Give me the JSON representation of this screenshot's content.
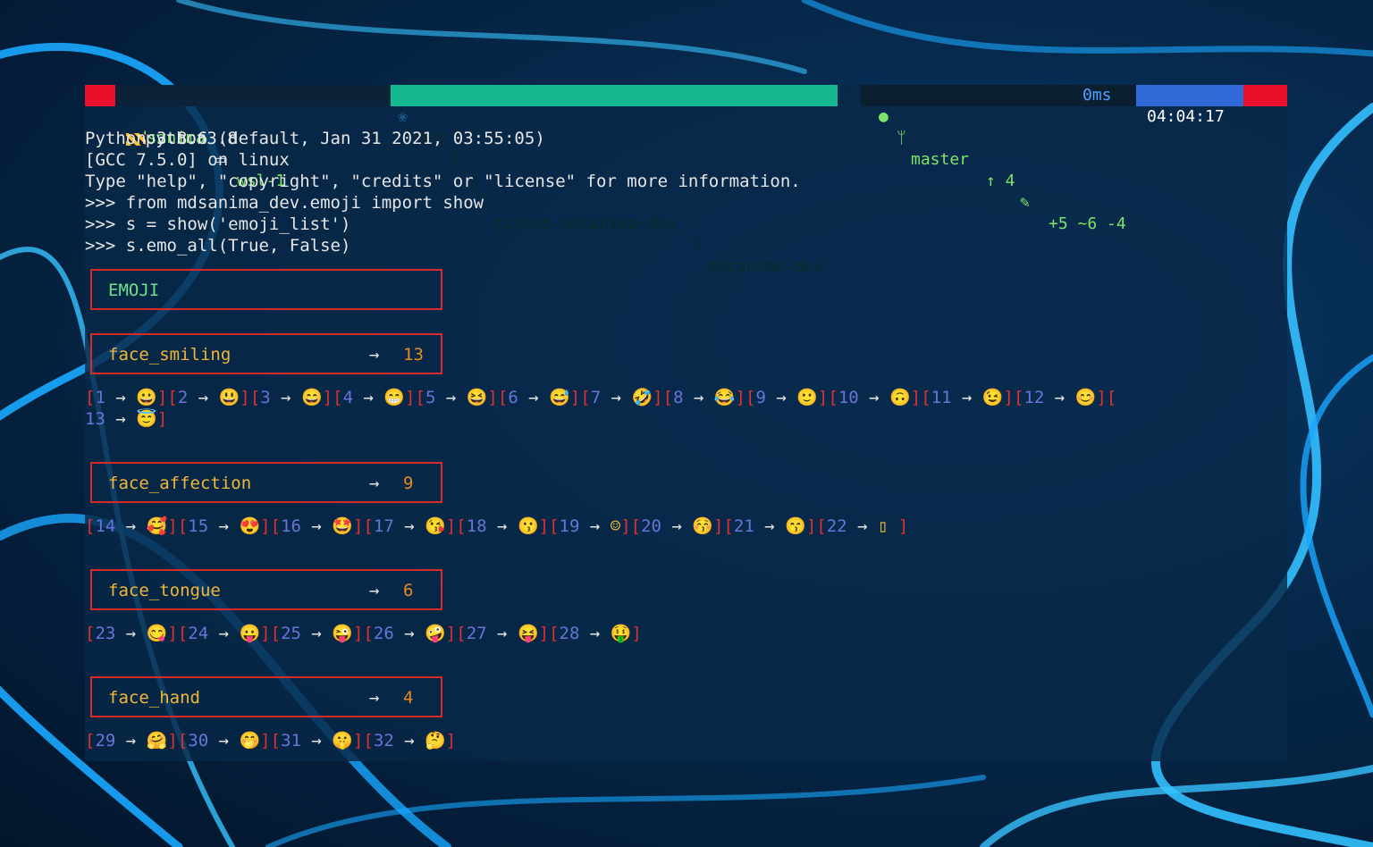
{
  "prompt": {
    "user": "mdsanima",
    "host": "wsl-1",
    "path": [
      "mnt",
      "j",
      "github-mdsanima-dev",
      "mdsanima-dev"
    ],
    "branch": "master",
    "git_status": "↑ 4",
    "changes": "+5 ~6 -4",
    "duration": "0ms",
    "clock": "04:04:17"
  },
  "lines": [
    "python3.8",
    "Python 3.8.6 (default, Jan 31 2021, 03:55:05)",
    "[GCC 7.5.0] on linux",
    "Type \"help\", \"copyright\", \"credits\" or \"license\" for more information.",
    ">>> from mdsanima_dev.emoji import show",
    ">>> s = show('emoji_list')",
    ">>> s.emo_all(True, False)"
  ],
  "header_box": {
    "title": "EMOJI"
  },
  "groups": [
    {
      "name": "face_smiling",
      "arrow": "→",
      "count": "13",
      "row1": "[1 → 😀][2 → 😃][3 → 😄][4 → 😁][5 → 😆][6 → 😅][7 → 🤣][8 → 😂][9 → 🙂][10 → 🙃][11 → 😉][12 → 😊][",
      "row2": "13 → 😇]"
    },
    {
      "name": "face_affection",
      "arrow": "→",
      "count": "9",
      "row1": "[14 → 🥰][15 → 😍][16 → 🤩][17 → 😘][18 → 😗][19 → ☺][20 → 😚][21 → 😙][22 → ▯ ]"
    },
    {
      "name": "face_tongue",
      "arrow": "→",
      "count": "6",
      "row1": "[23 → 😋][24 → 😛][25 → 😜][26 → 🤪][27 → 😝][28 → 🤑]"
    },
    {
      "name": "face_hand",
      "arrow": "→",
      "count": "4",
      "row1": "[29 → 🤗][30 → 🤭][31 → 🤫][32 → 🤔]"
    }
  ],
  "colors": {
    "accent_green": "#7ee36a",
    "path_teal": "#16b890",
    "clock_blue": "#2f6ad8",
    "border_red": "#d92a2a",
    "count_orange": "#e88b1e"
  }
}
